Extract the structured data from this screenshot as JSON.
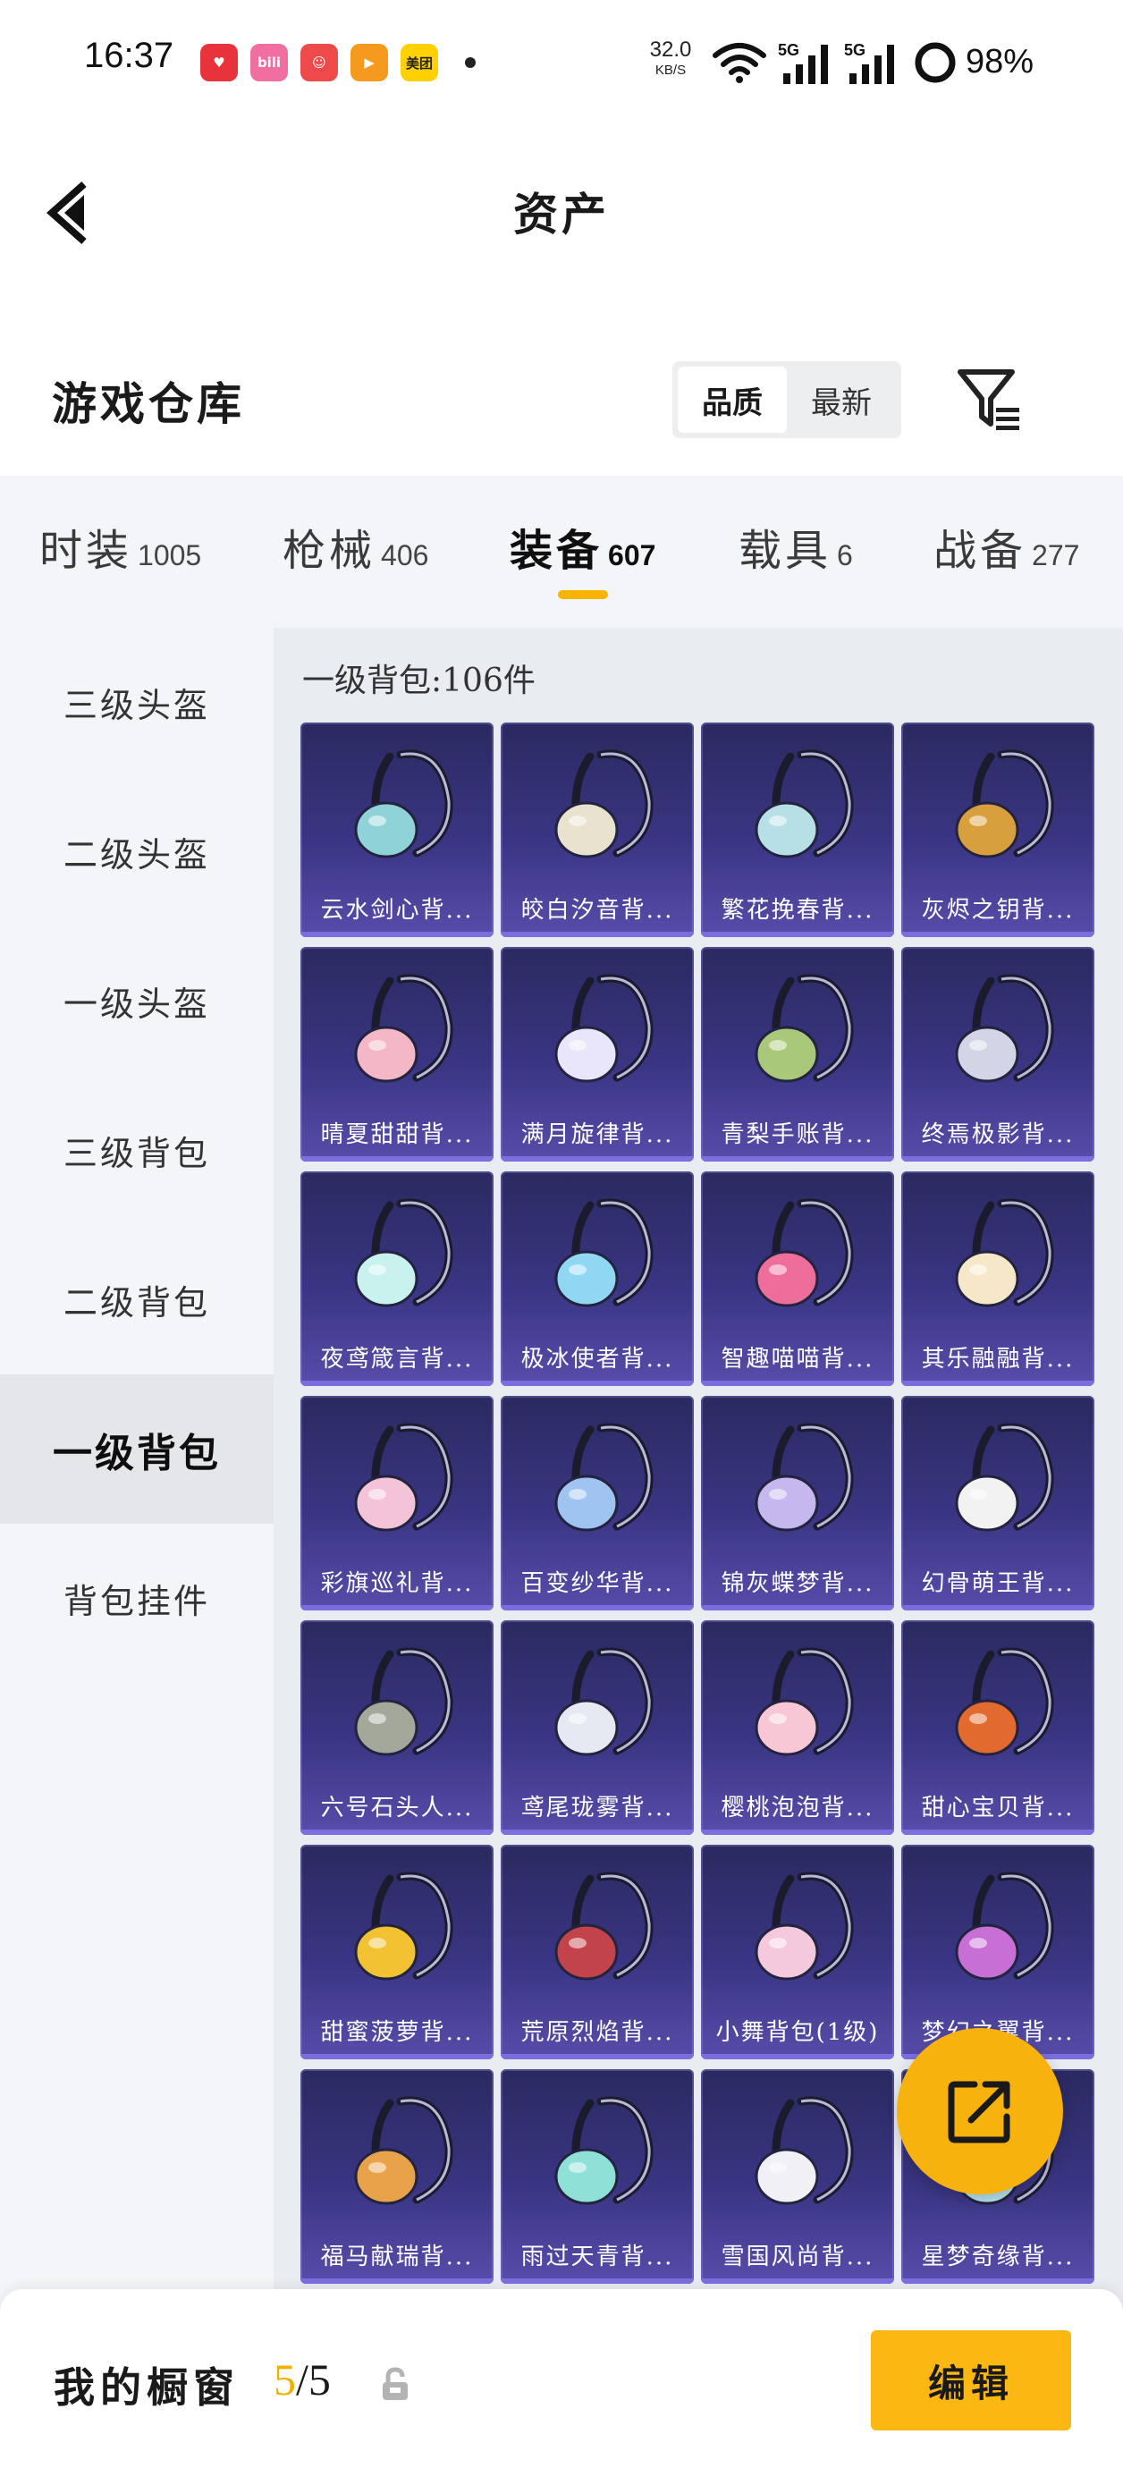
{
  "status_bar": {
    "time": "16:37",
    "apps": [
      {
        "name": "app-heart-icon",
        "label": "♥",
        "color": "#e8333c"
      },
      {
        "name": "bilibili-icon",
        "label": "bili",
        "color": "#f06ea0"
      },
      {
        "name": "app-cartoon-icon",
        "label": "☺",
        "color": "#ef4a4a"
      },
      {
        "name": "video-app-icon",
        "label": "▶",
        "color": "#f59a1c"
      },
      {
        "name": "meituan-icon",
        "label": "美团",
        "color": "#ffd100"
      }
    ],
    "net_speed": "32.0",
    "net_unit": "KB/S",
    "sim1": "5G",
    "sim2": "5G",
    "battery": "98%"
  },
  "header": {
    "title": "资产"
  },
  "warehouse": {
    "title": "游戏仓库",
    "sort_options": [
      "品质",
      "最新"
    ]
  },
  "tabs": [
    {
      "label": "时装",
      "count": "1005"
    },
    {
      "label": "枪械",
      "count": "406"
    },
    {
      "label": "装备",
      "count": "607"
    },
    {
      "label": "载具",
      "count": "6"
    },
    {
      "label": "战备",
      "count": "277"
    }
  ],
  "sidebar": [
    "三级头盔",
    "二级头盔",
    "一级头盔",
    "三级背包",
    "二级背包",
    "一级背包",
    "背包挂件"
  ],
  "content": {
    "count_line": "一级背包:106件"
  },
  "items": [
    {
      "name": "云水剑心背...",
      "color": "#8fd3d9"
    },
    {
      "name": "皎白汐音背...",
      "color": "#e8e2cf"
    },
    {
      "name": "繁花挽春背...",
      "color": "#b6dfe6"
    },
    {
      "name": "灰烬之钥背...",
      "color": "#d7a03c"
    },
    {
      "name": "晴夏甜甜背...",
      "color": "#f3b7c6"
    },
    {
      "name": "满月旋律背...",
      "color": "#e9e6fb"
    },
    {
      "name": "青梨手账背...",
      "color": "#a9c87a"
    },
    {
      "name": "终焉极影背...",
      "color": "#d3d4e6"
    },
    {
      "name": "夜鸢箴言背...",
      "color": "#c9f1ee"
    },
    {
      "name": "极冰使者背...",
      "color": "#8fd7f2"
    },
    {
      "name": "智趣喵喵背...",
      "color": "#ef6d9a"
    },
    {
      "name": "其乐融融背...",
      "color": "#f6e7c9"
    },
    {
      "name": "彩旗巡礼背...",
      "color": "#f3c4d8"
    },
    {
      "name": "百变纱华背...",
      "color": "#9fc4f2"
    },
    {
      "name": "锦灰蝶梦背...",
      "color": "#c6b7ef"
    },
    {
      "name": "幻骨萌王背...",
      "color": "#f2f2f2"
    },
    {
      "name": "六号石头人...",
      "color": "#a3a89a"
    },
    {
      "name": "鸢尾珑雾背...",
      "color": "#e6e9f1"
    },
    {
      "name": "樱桃泡泡背...",
      "color": "#f7c7d6"
    },
    {
      "name": "甜心宝贝背...",
      "color": "#e36a2e"
    },
    {
      "name": "甜蜜菠萝背...",
      "color": "#f2c232"
    },
    {
      "name": "荒原烈焰背...",
      "color": "#c2434a"
    },
    {
      "name": "小舞背包(1级)",
      "color": "#f5c9dc"
    },
    {
      "name": "梦幻之翼背...",
      "color": "#c86fd6"
    },
    {
      "name": "福马献瑞背...",
      "color": "#e8a24a"
    },
    {
      "name": "雨过天青背...",
      "color": "#8fe0d7"
    },
    {
      "name": "雪国风尚背...",
      "color": "#f0f0f5"
    },
    {
      "name": "星梦奇缘背...",
      "color": "#b7e4ef"
    }
  ],
  "bottom": {
    "label": "我的橱窗",
    "current": "5",
    "total": "/5",
    "edit": "编辑"
  },
  "colors": {
    "accent": "#f8b20e",
    "card_top": "#2a2a60",
    "card_bottom": "#584dab"
  }
}
